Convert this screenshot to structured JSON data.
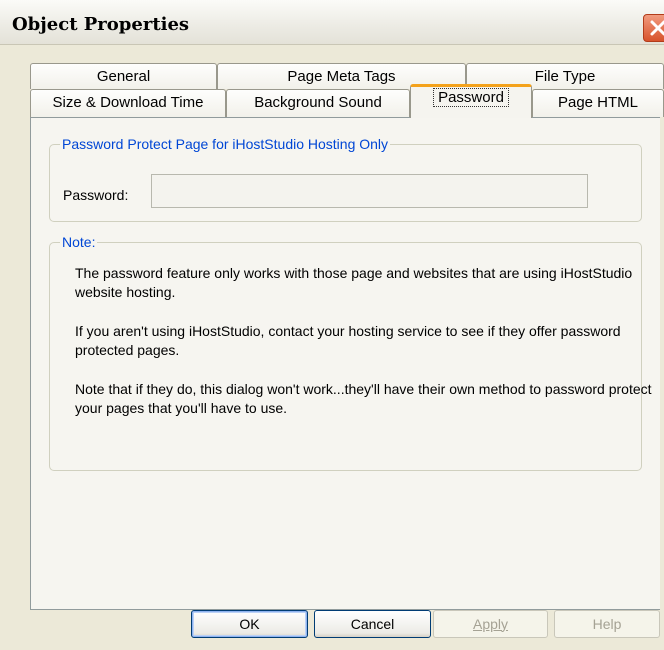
{
  "window": {
    "title": "Object Properties"
  },
  "tabs": {
    "row1": [
      {
        "label": "General"
      },
      {
        "label": "Page Meta Tags"
      },
      {
        "label": "File Type"
      }
    ],
    "row2": [
      {
        "label": "Size & Download Time"
      },
      {
        "label": "Background Sound"
      },
      {
        "label": "Password",
        "active": true
      },
      {
        "label": "Page HTML"
      }
    ]
  },
  "password_group": {
    "legend": "Password Protect Page for iHostStudio Hosting Only",
    "label": "Password:",
    "value": ""
  },
  "note_group": {
    "legend": "Note:",
    "paragraphs": [
      "The password feature only works with those page and websites that are using iHostStudio website hosting.",
      "If you aren't using iHostStudio, contact your hosting service to see if they offer  password protected pages.",
      "Note that if they do, this dialog won't work...they'll have their own method to password protect your pages that you'll have to use."
    ]
  },
  "buttons": {
    "ok": "OK",
    "cancel": "Cancel",
    "apply": "Apply",
    "help": "Help"
  },
  "colors": {
    "accent_tab": "#f4a21b",
    "legend_text": "#0046d5",
    "close_button": "#d8532c"
  }
}
